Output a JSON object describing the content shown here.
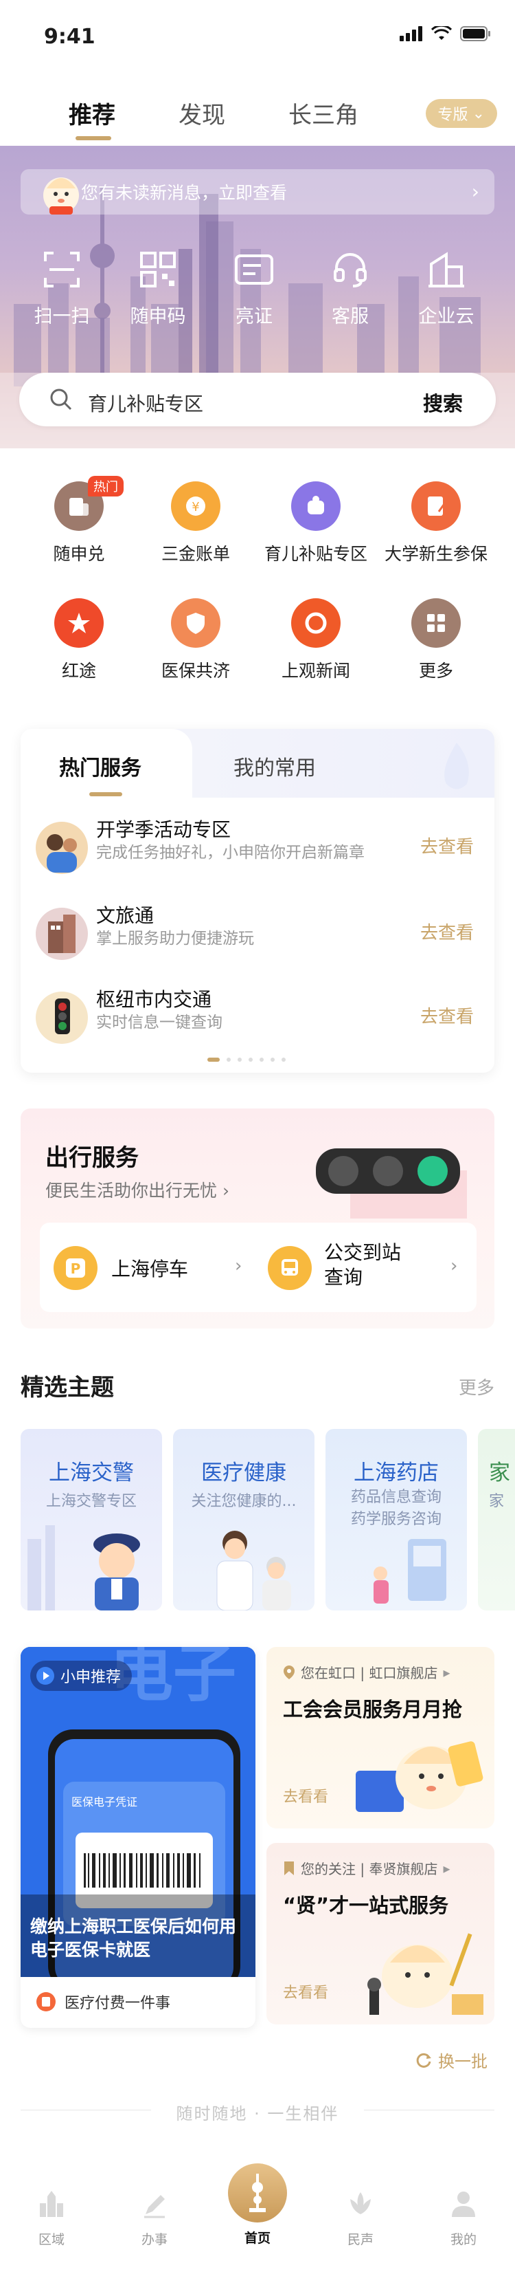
{
  "status_bar": {
    "time": "9:41"
  },
  "top_tabs": [
    {
      "label": "推荐"
    },
    {
      "label": "发现"
    },
    {
      "label": "长三角"
    }
  ],
  "edition_button": {
    "label": "专版"
  },
  "notice": {
    "text": "您有未读新消息，立即查看"
  },
  "quick_actions": [
    {
      "label": "扫一扫",
      "icon": "scan-icon"
    },
    {
      "label": "随申码",
      "icon": "qr-code-icon"
    },
    {
      "label": "亮证",
      "icon": "id-card-icon"
    },
    {
      "label": "客服",
      "icon": "headset-icon"
    },
    {
      "label": "企业云",
      "icon": "building-icon"
    }
  ],
  "search": {
    "placeholder": "育儿补贴专区",
    "button": "搜索"
  },
  "services": [
    {
      "label": "随申兑",
      "color": "#9d7a6c",
      "badge": "热门"
    },
    {
      "label": "三金账单",
      "color": "#f7a93a"
    },
    {
      "label": "育儿补贴专区",
      "color": "#8a76e6"
    },
    {
      "label": "大学新生参保",
      "color": "#f06a3d"
    },
    {
      "label": "红途",
      "color": "#ef4a2a"
    },
    {
      "label": "医保共济",
      "color": "#f28a55"
    },
    {
      "label": "上观新闻",
      "color": "#f05a28"
    },
    {
      "label": "更多",
      "color": "#a07e6e"
    }
  ],
  "hot_services": {
    "tabs": [
      {
        "label": "热门服务"
      },
      {
        "label": "我的常用"
      }
    ],
    "items": [
      {
        "title": "开学季活动专区",
        "subtitle": "完成任务抽好礼，小申陪你开启新篇章",
        "action": "去查看"
      },
      {
        "title": "文旅通",
        "subtitle": "掌上服务助力便捷游玩",
        "action": "去查看"
      },
      {
        "title": "枢纽市内交通",
        "subtitle": "实时信息一键查询",
        "action": "去查看"
      }
    ]
  },
  "travel": {
    "title": "出行服务",
    "subtitle": "便民生活助你出行无忧",
    "items": [
      {
        "label": "上海停车"
      },
      {
        "label": "公交到站查询"
      }
    ]
  },
  "themes": {
    "title": "精选主题",
    "more": "更多",
    "cards": [
      {
        "name": "上海交警",
        "desc": "上海交警专区",
        "desc2": ""
      },
      {
        "name": "医疗健康",
        "desc": "关注您健康的...",
        "desc2": ""
      },
      {
        "name": "上海药店",
        "desc": "药品信息查询",
        "desc2": "药学服务咨询"
      },
      {
        "name": "家",
        "desc": "家",
        "desc2": ""
      }
    ]
  },
  "recommend": {
    "tag": "小申推荐",
    "caption": "缴纳上海职工医保后如何用电子医保卡就医",
    "footer": "医疗付费一件事",
    "phone_card_label": "医保电子凭证",
    "right": [
      {
        "store": "您在虹口 | 虹口旗舰店",
        "title": "工会会员服务月月抢",
        "action": "去看看"
      },
      {
        "store": "您的关注 | 奉贤旗舰店",
        "title": "“贤”才一站式服务",
        "action": "去看看"
      }
    ],
    "swap": "换一批"
  },
  "slogan": "随时随地 · 一生相伴",
  "bottom_nav": [
    {
      "label": "区域"
    },
    {
      "label": "办事"
    },
    {
      "label": "首页"
    },
    {
      "label": "民声"
    },
    {
      "label": "我的"
    }
  ]
}
